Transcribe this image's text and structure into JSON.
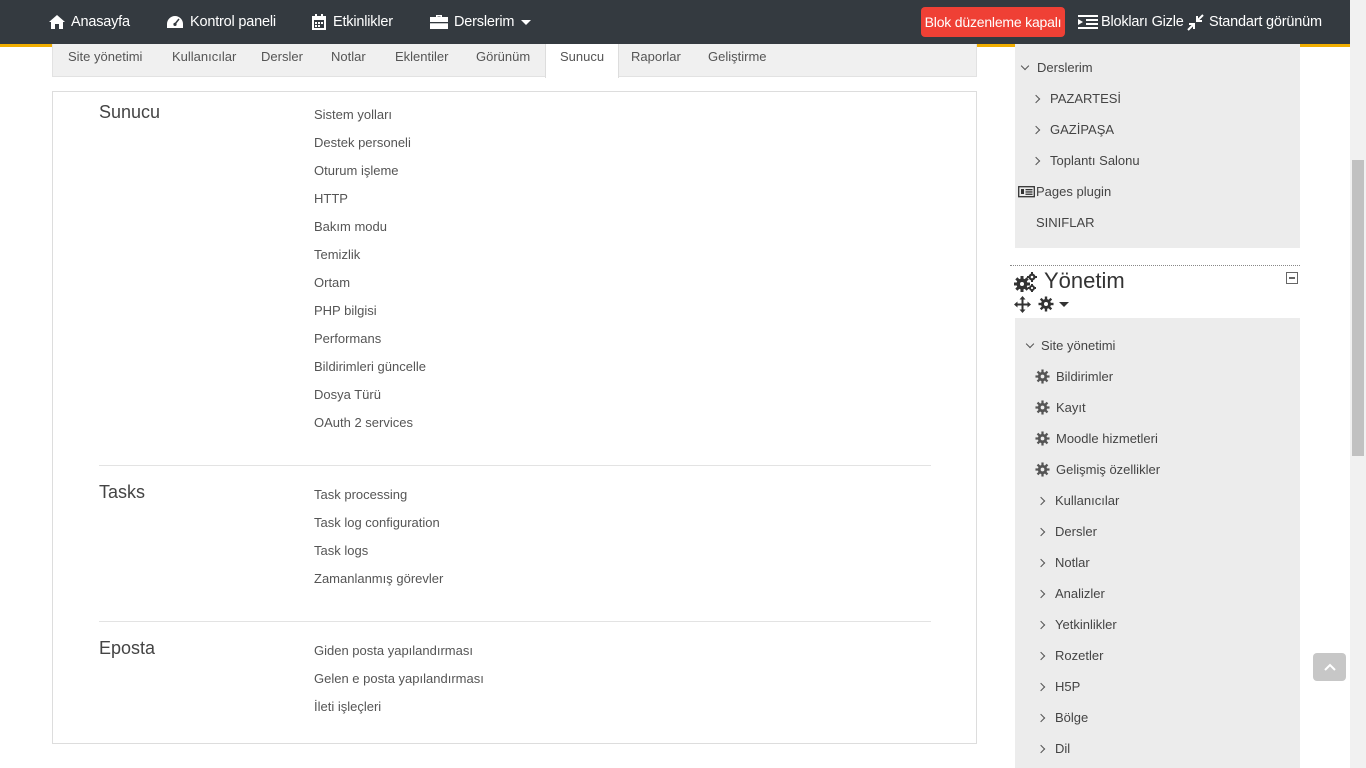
{
  "navbar": {
    "home": "Anasayfa",
    "dashboard": "Kontrol paneli",
    "events": "Etkinlikler",
    "my_courses": "Derslerim",
    "edit_toggle": "Blok düzenleme kapalı",
    "hide_blocks": "Blokları Gizle",
    "standard_view": "Standart görünüm",
    "accent_color": "#f0ad00",
    "edit_color": "#ef4035"
  },
  "tabs": [
    "Site yönetimi",
    "Kullanıcılar",
    "Dersler",
    "Notlar",
    "Eklentiler",
    "Görünüm",
    "Sunucu",
    "Raporlar",
    "Geliştirme"
  ],
  "active_tab": "Sunucu",
  "sections": [
    {
      "title": "Sunucu",
      "links": [
        "Sistem yolları",
        "Destek personeli",
        "Oturum işleme",
        "HTTP",
        "Bakım modu",
        "Temizlik",
        "Ortam",
        "PHP bilgisi",
        "Performans",
        "Bildirimleri güncelle",
        "Dosya Türü",
        "OAuth 2 services"
      ]
    },
    {
      "title": "Tasks",
      "links": [
        "Task processing",
        "Task log configuration",
        "Task logs",
        "Zamanlanmış görevler"
      ]
    },
    {
      "title": "Eposta",
      "links": [
        "Giden posta yapılandırması",
        "Gelen e posta yapılandırması",
        "İleti işleçleri"
      ]
    }
  ],
  "navigation_block": {
    "my_courses": "Derslerim",
    "courses": [
      "PAZARTESİ",
      "GAZİPAŞA",
      "Toplantı Salonu"
    ],
    "pages_plugin": "Pages plugin",
    "classes": "SINIFLAR"
  },
  "admin_block": {
    "title": "Yönetim",
    "site_admin": "Site yönetimi",
    "gear_items": [
      "Bildirimler",
      "Kayıt",
      "Moodle hizmetleri",
      "Gelişmiş özellikler"
    ],
    "items": [
      "Kullanıcılar",
      "Dersler",
      "Notlar",
      "Analizler",
      "Yetkinlikler",
      "Rozetler",
      "H5P",
      "Bölge",
      "Dil"
    ]
  }
}
